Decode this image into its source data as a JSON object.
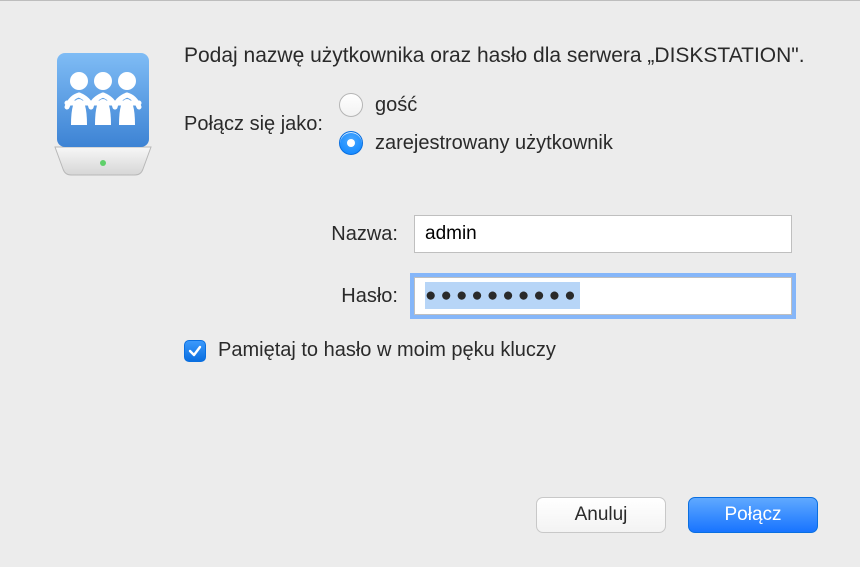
{
  "prompt": "Podaj nazwę użytkownika oraz hasło dla serwera „DISKSTATION\".",
  "connect_as": {
    "label": "Połącz się jako:",
    "guest": "gość",
    "registered": "zarejestrowany użytkownik",
    "selected": "registered"
  },
  "fields": {
    "name_label": "Nazwa:",
    "name_value": "admin",
    "password_label": "Hasło:",
    "password_mask": "●●●●●●●●●●"
  },
  "remember": {
    "label": "Pamiętaj to hasło w moim pęku kluczy",
    "checked": true
  },
  "buttons": {
    "cancel": "Anuluj",
    "connect": "Połącz"
  }
}
